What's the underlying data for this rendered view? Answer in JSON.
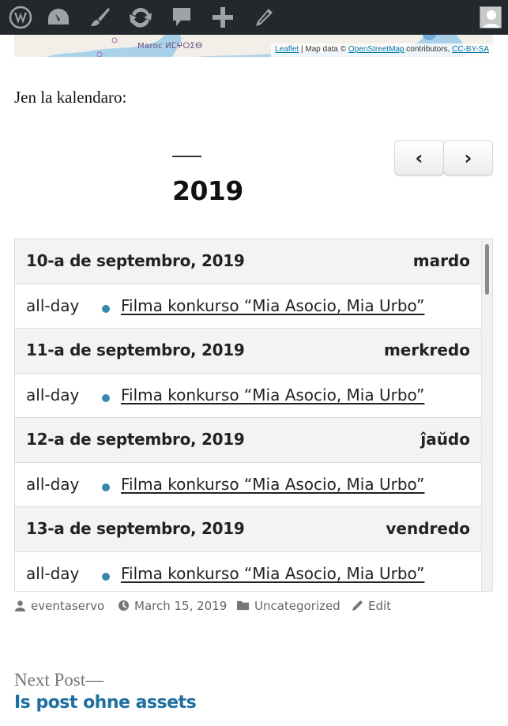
{
  "adminbar": {
    "items": [
      "wordpress-icon",
      "dashboard-icon",
      "customize-icon",
      "updates-icon",
      "comments-icon",
      "new-icon",
      "edit-icon"
    ],
    "accent": "#23282d"
  },
  "map": {
    "place_label": "Maroc ⵍⵎⵖⵔⵉⴱ",
    "attribution": {
      "leaflet": "Leaflet",
      "sep": " | Map data © ",
      "osm": "OpenStreetMap",
      "contrib": " contributors, ",
      "license": "CC-BY-SA"
    }
  },
  "intro": "Jen la kalendaro:",
  "calendar": {
    "year": "2019",
    "prev_label": "‹",
    "next_label": "›",
    "days": [
      {
        "date": "10-a de septembro, 2019",
        "weekday": "mardo",
        "time": "all-day",
        "event": "Filma konkurso “Mia Asocio, Mia Urbo”"
      },
      {
        "date": "11-a de septembro, 2019",
        "weekday": "merkredo",
        "time": "all-day",
        "event": "Filma konkurso “Mia Asocio, Mia Urbo”"
      },
      {
        "date": "12-a de septembro, 2019",
        "weekday": "ĵaŭdo",
        "time": "all-day",
        "event": "Filma konkurso “Mia Asocio, Mia Urbo”"
      },
      {
        "date": "13-a de septembro, 2019",
        "weekday": "vendredo",
        "time": "all-day",
        "event": "Filma konkurso “Mia Asocio, Mia Urbo”"
      }
    ],
    "event_color": "#3a87ad"
  },
  "meta": {
    "author": "eventaservo",
    "date": "March 15, 2019",
    "category": "Uncategorized",
    "edit": "Edit"
  },
  "nav": {
    "label": "Next Post—",
    "title": "Is post ohne assets"
  }
}
